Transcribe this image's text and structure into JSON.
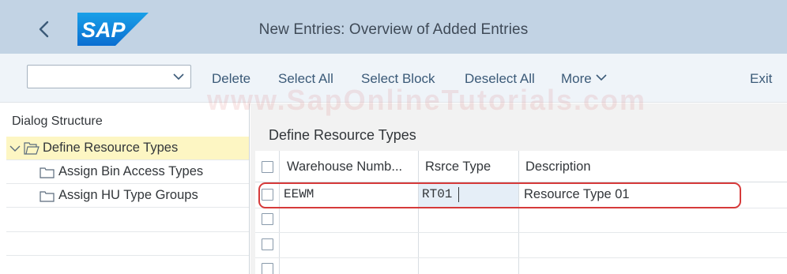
{
  "header": {
    "title": "New Entries: Overview of Added Entries",
    "logo_text": "SAP",
    "logo_color": "#0a6ed1"
  },
  "toolbar": {
    "dropdown_value": "",
    "delete_label": "Delete",
    "select_all_label": "Select All",
    "select_block_label": "Select Block",
    "deselect_all_label": "Deselect All",
    "more_label": "More",
    "exit_label": "Exit"
  },
  "watermark": "www.SapOnlineTutorials.com",
  "dialog_structure": {
    "heading": "Dialog Structure",
    "items": [
      {
        "label": "Define Resource Types",
        "selected": true
      },
      {
        "label": "Assign Bin Access Types",
        "selected": false
      },
      {
        "label": "Assign HU Type Groups",
        "selected": false
      }
    ]
  },
  "table": {
    "title": "Define Resource Types",
    "columns": [
      "Warehouse Numb...",
      "Rsrce Type",
      "Description"
    ],
    "rows": [
      {
        "warehouse": "EEWM",
        "resource_type": "RT01",
        "description": "Resource Type 01"
      }
    ]
  },
  "colors": {
    "header_bg": "#c2d3e4",
    "toolbar_bg": "#eff4f9",
    "selected_tree_bg": "#fdf6c3",
    "highlight_ring": "#d63a3a",
    "link_text": "#3b5a78"
  },
  "icons": [
    "back-icon",
    "chevron-down-icon",
    "folder-open-icon",
    "folder-icon",
    "checkbox-icon"
  ]
}
